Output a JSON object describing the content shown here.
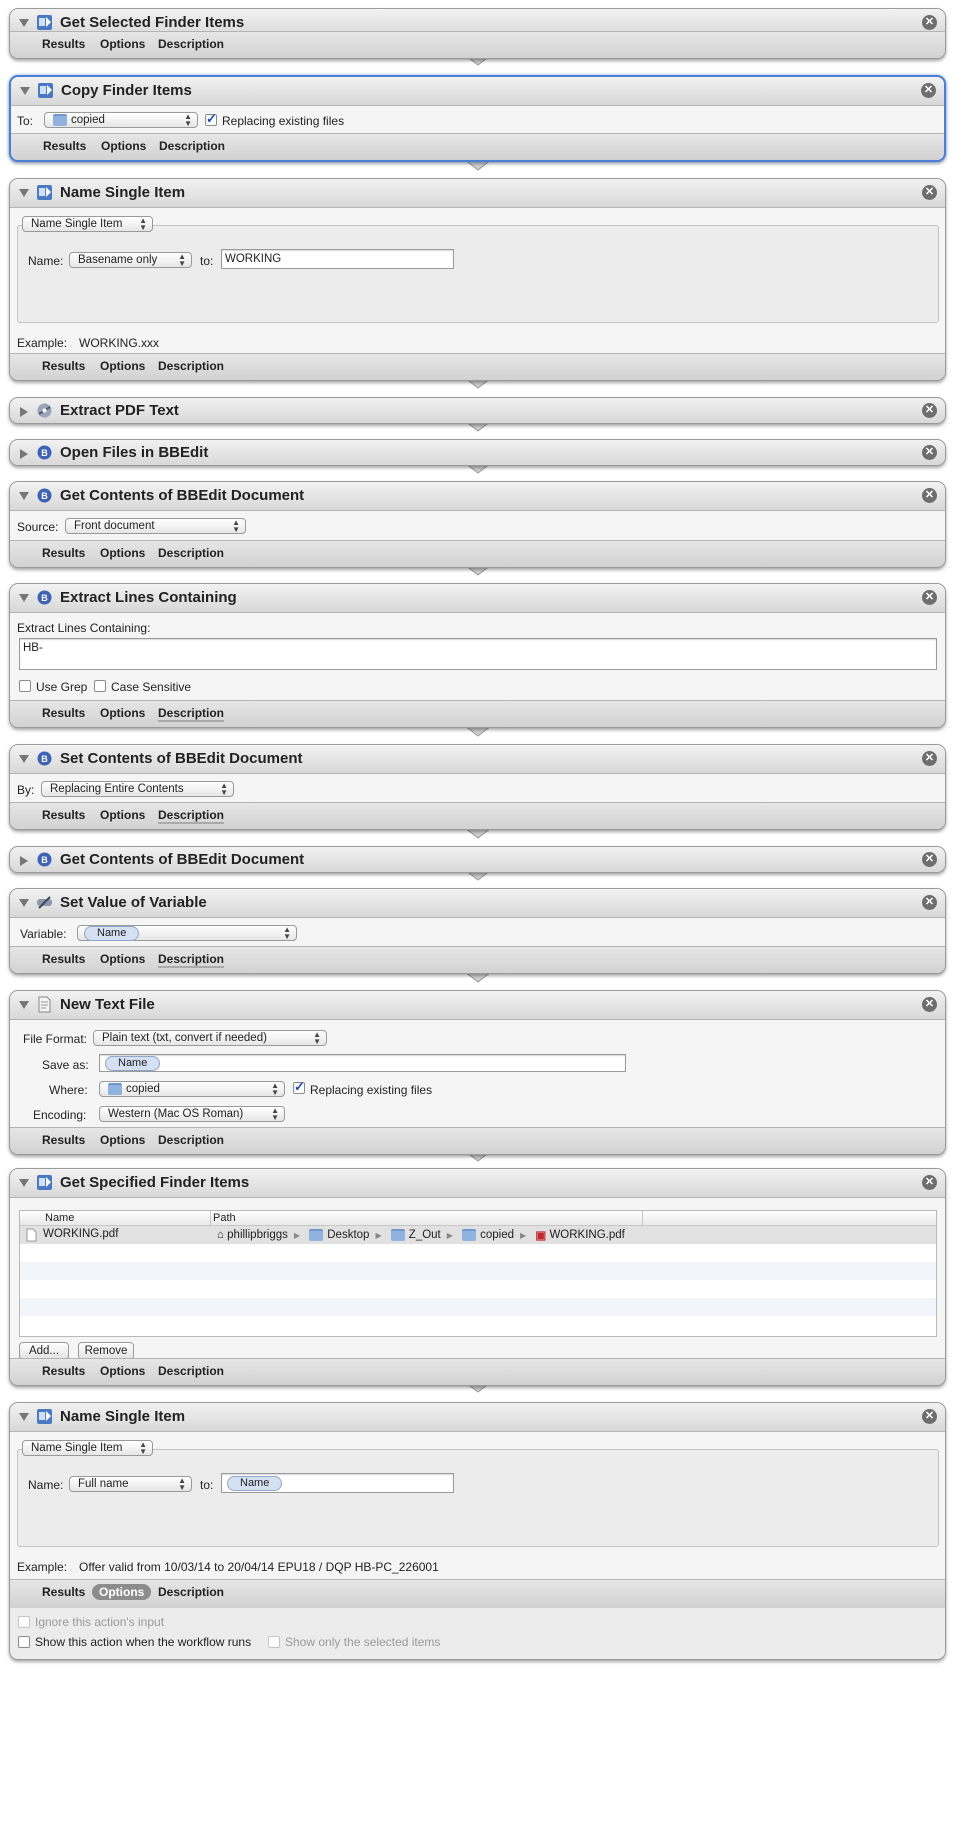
{
  "footer_tabs": {
    "results": "Results",
    "options": "Options",
    "description": "Description"
  },
  "a1": {
    "title": "Get Selected Finder Items"
  },
  "a2": {
    "title": "Copy Finder Items",
    "to_label": "To:",
    "to_value": "copied",
    "replace_label": "Replacing existing files"
  },
  "a3": {
    "title": "Name Single Item",
    "mode": "Name Single Item",
    "name_label": "Name:",
    "name_option": "Basename only",
    "to_label": "to:",
    "to_value": "WORKING",
    "example_label": "Example:",
    "example_value": "WORKING.xxx"
  },
  "a4": {
    "title": "Extract PDF Text"
  },
  "a5": {
    "title": "Open Files in BBEdit"
  },
  "a6": {
    "title": "Get Contents of BBEdit Document",
    "source_label": "Source:",
    "source_value": "Front document"
  },
  "a7": {
    "title": "Extract Lines Containing",
    "field_label": "Extract Lines Containing:",
    "field_value": "HB-",
    "grep_label": "Use Grep",
    "case_label": "Case Sensitive"
  },
  "a8": {
    "title": "Set Contents of BBEdit Document",
    "by_label": "By:",
    "by_value": "Replacing Entire Contents"
  },
  "a9": {
    "title": "Get Contents of BBEdit Document"
  },
  "a10": {
    "title": "Set Value of Variable",
    "variable_label": "Variable:",
    "variable_token": "Name"
  },
  "a11": {
    "title": "New Text File",
    "format_label": "File Format:",
    "format_value": "Plain text (txt, convert if needed)",
    "saveas_label": "Save as:",
    "saveas_token": "Name",
    "where_label": "Where:",
    "where_value": "copied",
    "replace_label": "Replacing existing files",
    "encoding_label": "Encoding:",
    "encoding_value": "Western (Mac OS Roman)"
  },
  "a12": {
    "title": "Get Specified Finder Items",
    "col_name": "Name",
    "col_path": "Path",
    "row_name": "WORKING.pdf",
    "path": [
      "phillipbriggs",
      "Desktop",
      "Z_Out",
      "copied",
      "WORKING.pdf"
    ],
    "add_label": "Add...",
    "remove_label": "Remove"
  },
  "a13": {
    "title": "Name Single Item",
    "mode": "Name Single Item",
    "name_label": "Name:",
    "name_option": "Full name",
    "to_label": "to:",
    "to_token": "Name",
    "example_label": "Example:",
    "example_value": "Offer valid from 10/03/14 to 20/04/14 EPU18 / DQP HB-PC_226001",
    "ignore_label": "Ignore this action's input",
    "show_label": "Show this action when the workflow runs",
    "selected_only_label": "Show only the selected items"
  }
}
